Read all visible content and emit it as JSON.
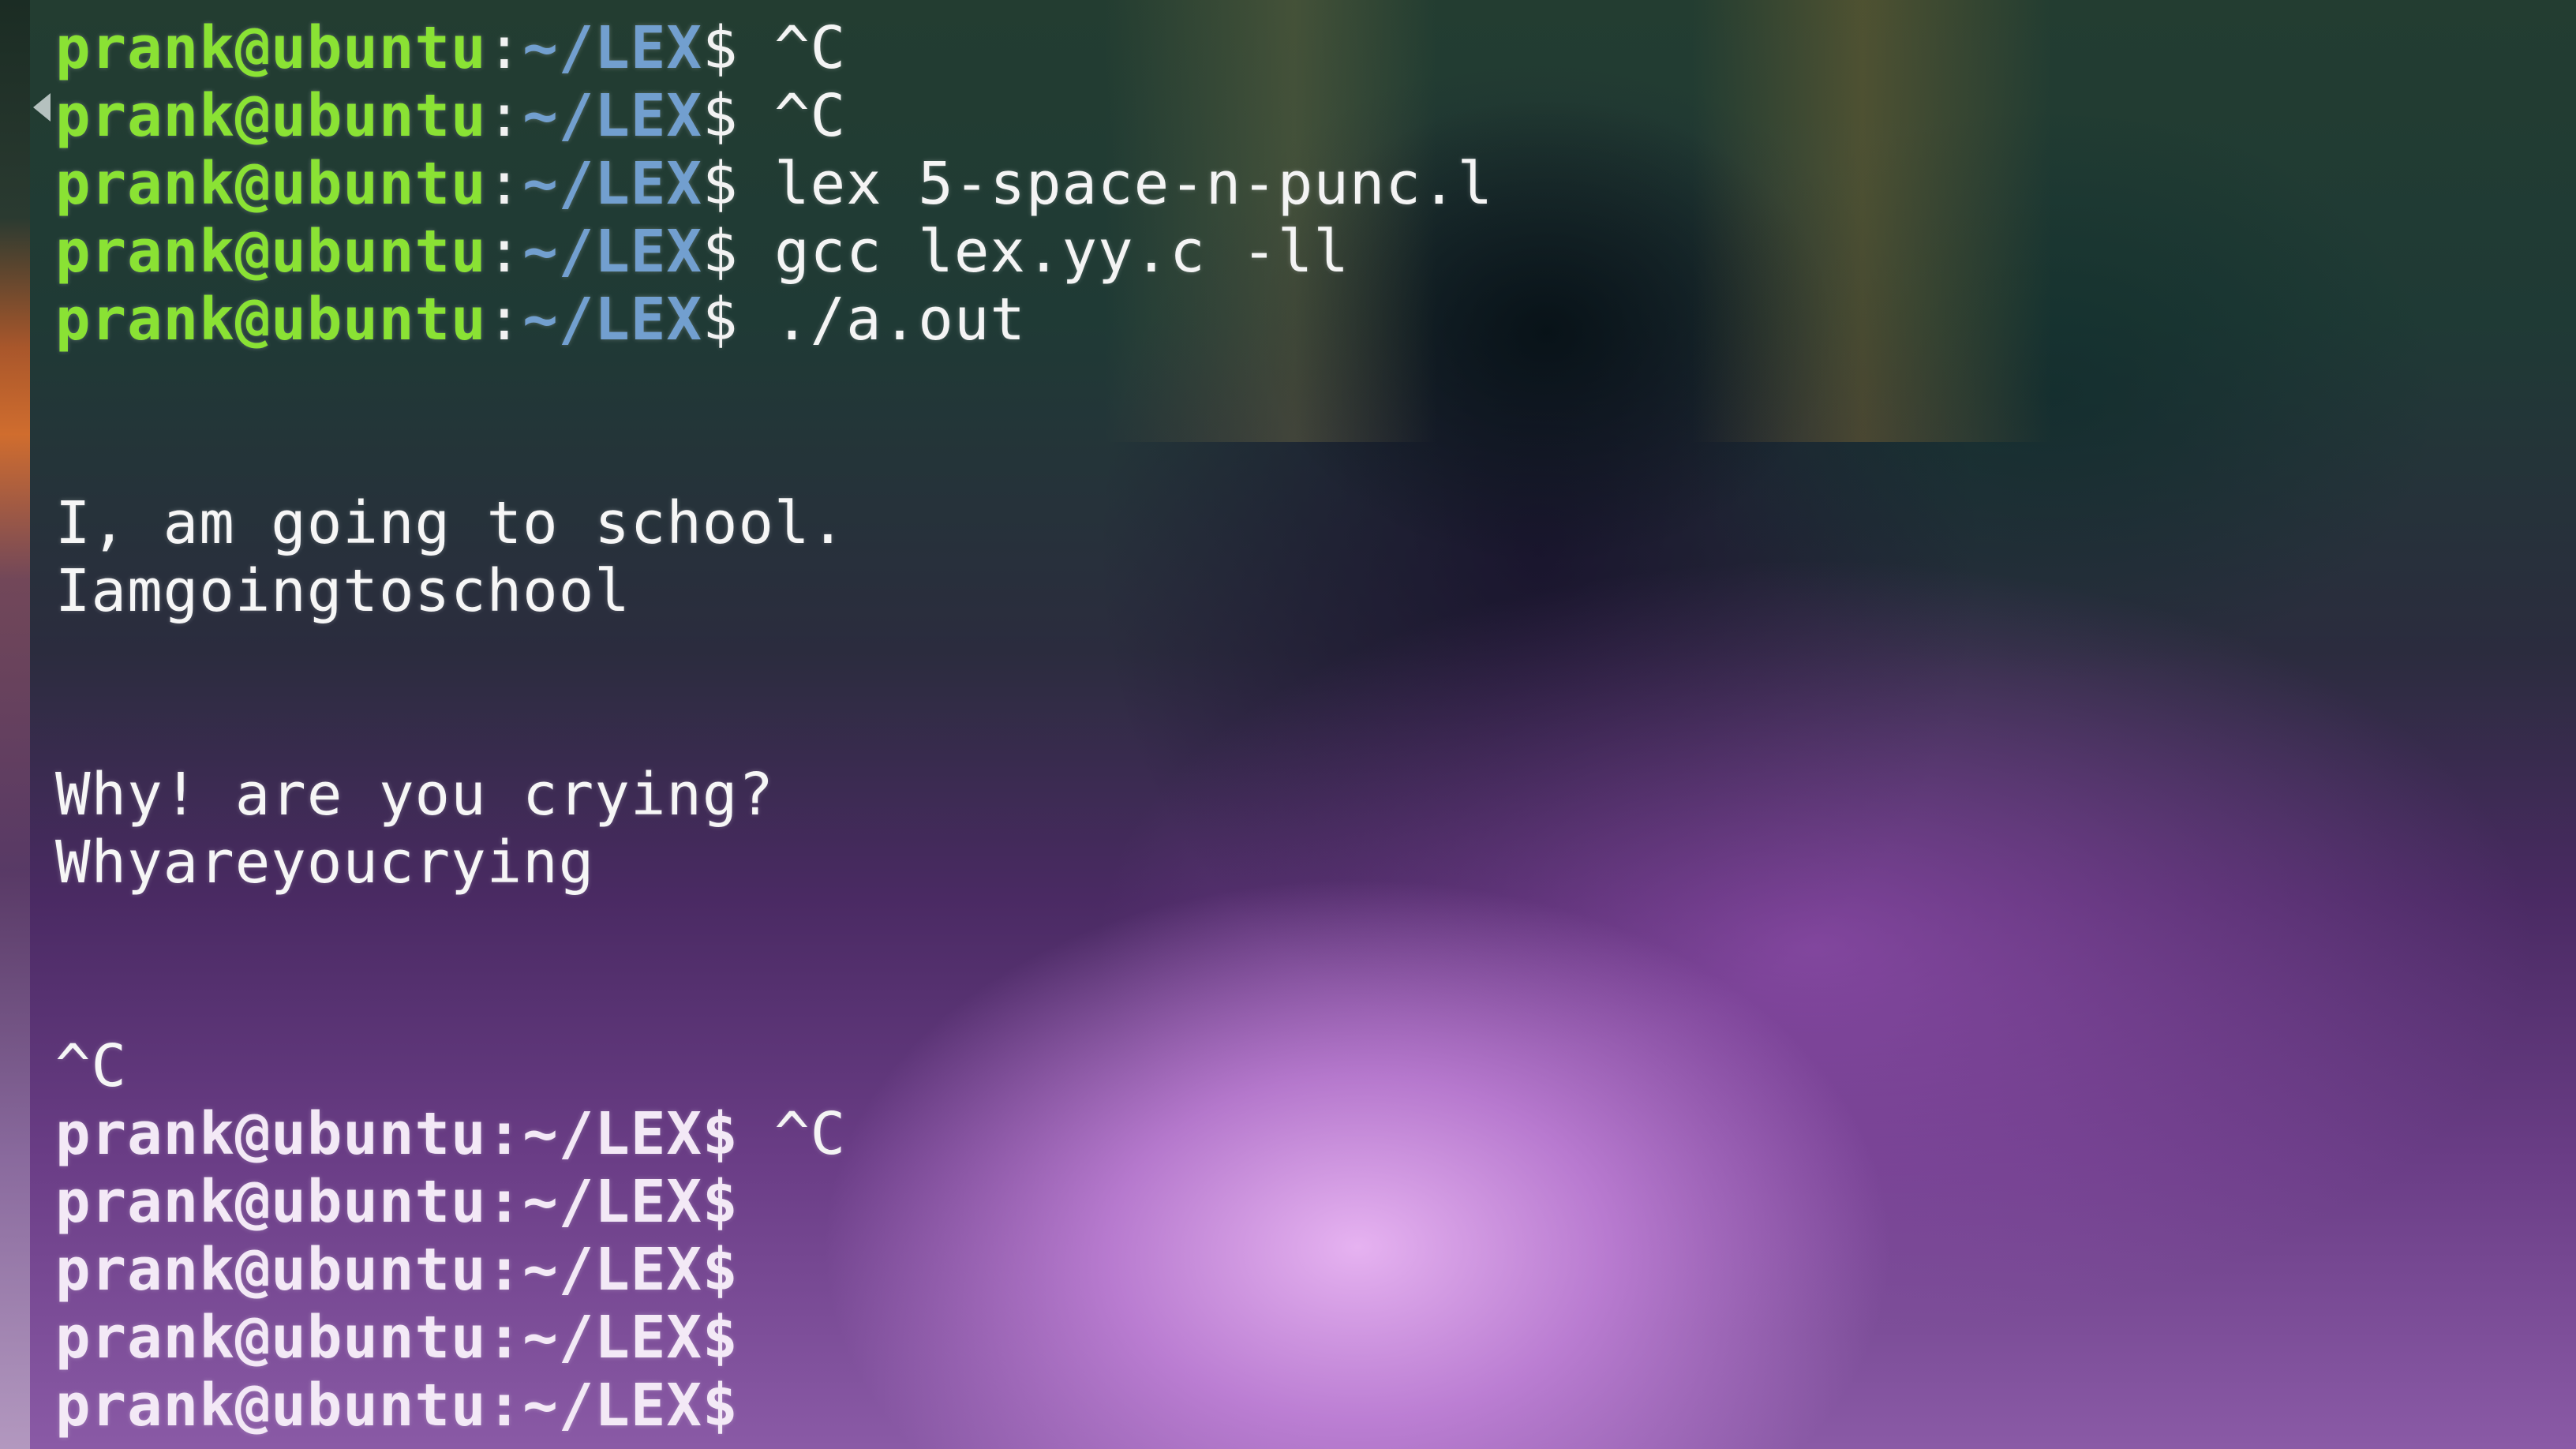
{
  "prompt": {
    "user_host": "prank@ubuntu",
    "separator": ":",
    "path": "~/LEX",
    "symbol": "$"
  },
  "lines": [
    {
      "kind": "prompt",
      "command": "^C",
      "style": "color"
    },
    {
      "kind": "prompt",
      "command": "^C",
      "style": "color"
    },
    {
      "kind": "prompt",
      "command": "lex 5-space-n-punc.l",
      "style": "color"
    },
    {
      "kind": "prompt",
      "command": "gcc lex.yy.c -ll",
      "style": "color"
    },
    {
      "kind": "prompt",
      "command": "./a.out",
      "style": "color"
    },
    {
      "kind": "blank"
    },
    {
      "kind": "blank"
    },
    {
      "kind": "output",
      "text": "I, am going to school."
    },
    {
      "kind": "output",
      "text": "Iamgoingtoschool"
    },
    {
      "kind": "blank"
    },
    {
      "kind": "blank"
    },
    {
      "kind": "output",
      "text": "Why! are you crying?"
    },
    {
      "kind": "output",
      "text": "Whyareyoucrying"
    },
    {
      "kind": "blank"
    },
    {
      "kind": "blank"
    },
    {
      "kind": "output",
      "text": "^C"
    },
    {
      "kind": "prompt",
      "command": "^C",
      "style": "plain"
    },
    {
      "kind": "prompt",
      "command": "",
      "style": "plain"
    },
    {
      "kind": "prompt",
      "command": "",
      "style": "plain"
    },
    {
      "kind": "prompt",
      "command": "",
      "style": "plain"
    },
    {
      "kind": "prompt",
      "command": "",
      "style": "plain"
    }
  ],
  "colors": {
    "user_host": "#8ae234",
    "path": "#729fcf",
    "text": "#f2f2f2"
  }
}
